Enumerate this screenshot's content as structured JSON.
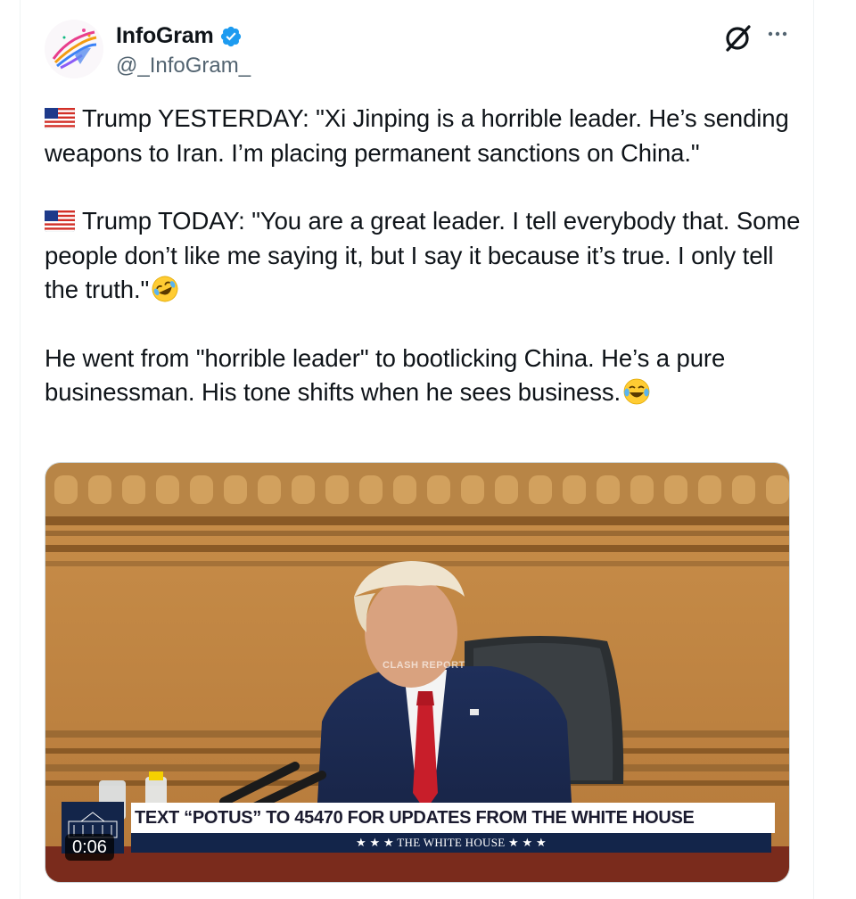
{
  "author": {
    "display_name": "InfoGram",
    "handle": "@_InfoGram_",
    "verified": true,
    "avatar_icon": "infogram-logo-icon"
  },
  "header_actions": {
    "grok_icon": "grok-icon",
    "more_icon": "more-icon"
  },
  "tweet": {
    "paragraph_1": "Trump YESTERDAY: \"Xi Jinping is a horrible leader. He’s sending weapons to Iran. I’m placing permanent sanctions on China.\"",
    "paragraph_2": "Trump TODAY: \"You are a great leader. I tell everybody that. Some people don’t like me saying it, but I say it because it’s true. I only tell the truth.\"",
    "paragraph_3": "He went from \"horrible leader\" to bootlicking China. He’s a pure businessman. His tone shifts when he sees business.",
    "emoji_1": "rolling-on-floor-laughing-emoji",
    "emoji_2": "tears-of-joy-emoji",
    "flag_icon": "us-flag-emoji"
  },
  "video": {
    "banner_text": "TEXT “POTUS” TO 45470 FOR UPDATES FROM THE WHITE HOUSE",
    "banner_subtext": "★ ★ ★   THE WHITE HOUSE   ★ ★ ★",
    "watermark": "CLASH REPORT",
    "timestamp": "0:06"
  },
  "colors": {
    "verified_blue": "#1d9bf0",
    "text": "#0f1419",
    "secondary_text": "#536471",
    "banner_navy": "#13254a"
  }
}
